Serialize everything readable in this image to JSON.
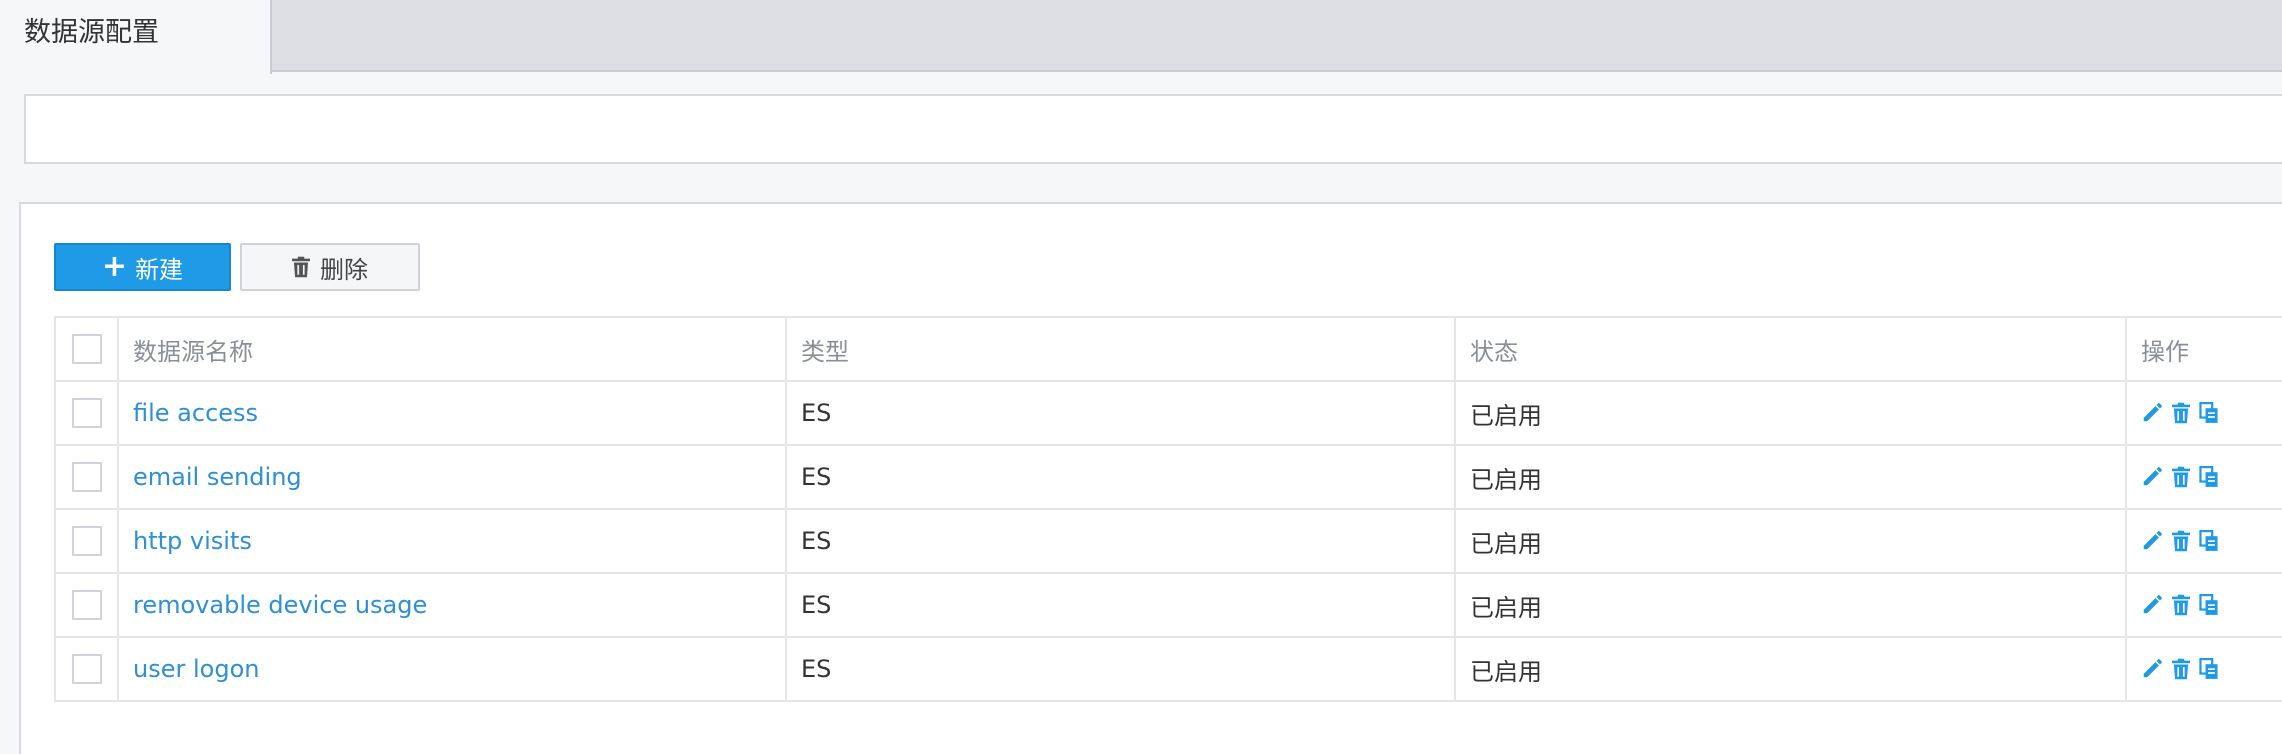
{
  "tabs": {
    "active_label": "数据源配置"
  },
  "toolbar": {
    "new_label": "新建",
    "delete_label": "删除"
  },
  "table": {
    "headers": {
      "name": "数据源名称",
      "type": "类型",
      "status": "状态",
      "ops": "操作"
    },
    "rows": [
      {
        "name": "file access",
        "type": "ES",
        "status": "已启用"
      },
      {
        "name": "email sending",
        "type": "ES",
        "status": "已启用"
      },
      {
        "name": "http visits",
        "type": "ES",
        "status": "已启用"
      },
      {
        "name": "removable device usage",
        "type": "ES",
        "status": "已启用"
      },
      {
        "name": "user logon",
        "type": "ES",
        "status": "已启用"
      }
    ],
    "row_actions": [
      "edit-icon",
      "trash-icon",
      "copy-icon"
    ]
  },
  "colors": {
    "accent": "#1e9ae6",
    "link": "#2d8fd5",
    "icon": "#1e9ae6"
  }
}
